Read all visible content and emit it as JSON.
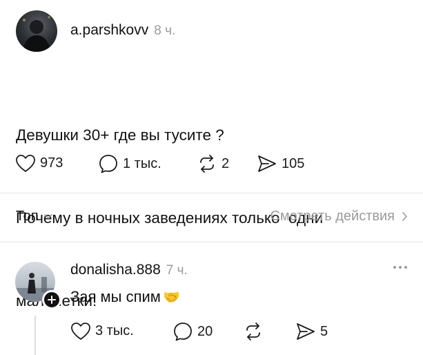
{
  "post": {
    "author": "a.parshkovv",
    "time": "8 ч.",
    "text_lines": [
      "Девушки 30+ где вы тусите ?",
      "Почему в ночных заведениях только  одни",
      "малолетки!"
    ],
    "likes": "973",
    "comments": "1 тыс.",
    "reposts": "2",
    "shares": "105"
  },
  "sort_bar": {
    "label": "Топ",
    "activity_link": "Смотреть действия"
  },
  "reply": {
    "author": "donalisha.888",
    "time": "7 ч.",
    "text": "Зая мы спим",
    "emoji": "🤝",
    "likes": "3 тыс.",
    "comments": "20",
    "shares": "5"
  },
  "icons": {
    "like": "heart-icon",
    "comment": "comment-bubble-icon",
    "repost": "repost-icon",
    "share": "send-icon",
    "more": "more-dots-icon",
    "follow": "plus-icon",
    "sort": "chevron-down-icon",
    "link": "chevron-right-icon"
  },
  "colors": {
    "text": "#111111",
    "muted": "#9a9a9a",
    "divider": "#e6e6e6"
  }
}
